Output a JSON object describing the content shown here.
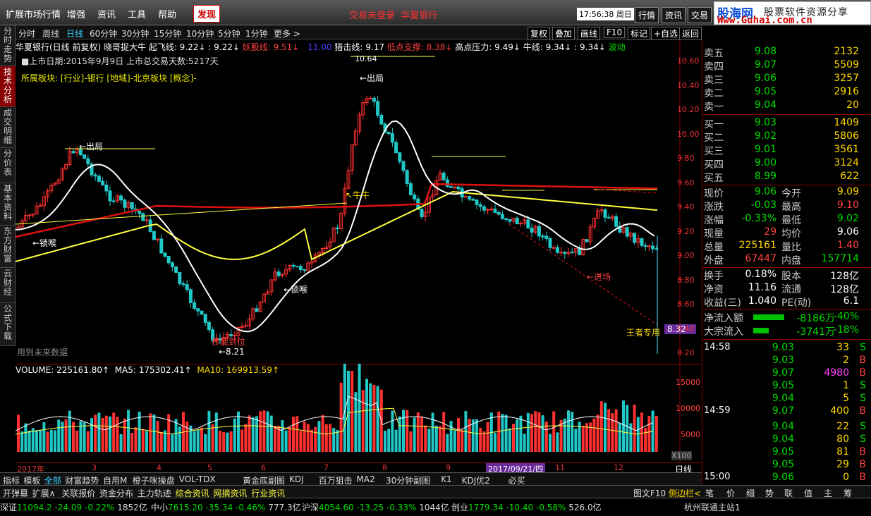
{
  "top_menu": [
    "扩展市场行情",
    "增强",
    "资讯",
    "工具",
    "帮助",
    "发现"
  ],
  "login_status": "交易未登录",
  "stock_header": "华夏银行",
  "clock": "17:56:38 周日",
  "top_buttons": [
    "行情",
    "资讯",
    "交易"
  ],
  "logo": {
    "name": "股海网",
    "slogan": "股票软件资源分享",
    "url": "Www.Guhai.com.cn"
  },
  "left_tabs": [
    "分时走势",
    "技术分析",
    "成交明细",
    "分价表",
    "基本资料",
    "东方财富",
    "云财经",
    "公式下载"
  ],
  "periods": [
    "分时",
    "周线",
    "日线",
    "60分钟",
    "30分钟",
    "15分钟",
    "10分钟",
    "5分钟",
    "1分钟",
    "更多 >"
  ],
  "tools": [
    "复权",
    "叠加",
    "画线",
    "F10",
    "标记",
    "+自选",
    "返回"
  ],
  "indicator_line": {
    "name": "华夏银行(日线 前复权) 晓哥捉大牛",
    "qfx": "起飞线: 9.22↓ : 9.22↓",
    "yfx": "妖股线: 9.51↓",
    "nums": "11.00",
    "ljx": "猎击线: 9.17",
    "ddzc": "低点支撑: 8.38↓",
    "gdyl": "高点压力: 9.49↓",
    "nx": "牛线: 9.34↓ : 9.34↓",
    "bd": "波动"
  },
  "listing_info": "■上市日期:2015年9月9日 上市总交易天数:5217天",
  "sector_info": "所属板块: [行业]-银行 [地域]-北京板块 [概念]-",
  "annotations": {
    "top_high": "10.64",
    "exit1": "←出局",
    "exit2": "←出局",
    "bull": "↖牛牛",
    "lock1": "←锁喉",
    "lock2": "←锁喉",
    "entry": "←进场",
    "bottom": "抄底到位",
    "low": "←8.21",
    "king": "王者专用",
    "price_tag": "8.32",
    "future": "用到未来数据"
  },
  "y_ticks": [
    "10.60",
    "10.40",
    "10.20",
    "10.00",
    "9.80",
    "9.60",
    "9.40",
    "9.20",
    "9.00",
    "8.80",
    "8.60",
    "8.40",
    "8.20"
  ],
  "volume_line": {
    "vol": "VOLUME: 225161.80↑",
    "ma5": "MA5: 175302.41↑",
    "ma10": "MA10: 169913.59↑"
  },
  "vol_ticks": [
    "15000",
    "10000",
    "5000",
    "X100"
  ],
  "dates": [
    "2017年",
    "3",
    "4",
    "5",
    "6",
    "7",
    "8",
    "9",
    "2017/09/21/四",
    "11",
    "12"
  ],
  "timeframe_label": "日线",
  "bottom_tabs": [
    "指标",
    "模板",
    "全部",
    "财富趋势",
    "自用M",
    "橙子咪操盘",
    "VOL-TDX",
    "黄金底副图",
    "KDJ",
    "百万狙击",
    "MA2",
    "30分钟副图",
    "K1",
    "KDJ优2",
    "必买"
  ],
  "bottom_tabs2": [
    "开弹幕",
    "扩展∧",
    "关联报价",
    "资金分布",
    "主力轨迹",
    "综合资讯",
    "网摘资讯",
    "行业资讯",
    "图文F10",
    "侧边栏<",
    "笔",
    "价",
    "细",
    "势",
    "联",
    "值",
    "主",
    "筹"
  ],
  "status": [
    {
      "n": "深证",
      "v": "11094.2",
      "c": "-24.09",
      "p": "-0.22%",
      "a": "1852亿"
    },
    {
      "n": "中小",
      "v": "7615.20",
      "c": "-35.34",
      "p": "-0.46%",
      "a": "777.3亿"
    },
    {
      "n": "沪深",
      "v": "4054.60",
      "c": "-13.25",
      "p": "-0.33%",
      "a": "1044亿"
    },
    {
      "n": "创业",
      "v": "1779.34",
      "c": "-10.40",
      "p": "-0.58%",
      "a": "526.0亿"
    }
  ],
  "server": "杭州联通主站1",
  "order_book": {
    "asks": [
      {
        "l": "卖五",
        "p": "9.08",
        "v": "2132"
      },
      {
        "l": "卖四",
        "p": "9.07",
        "v": "5509"
      },
      {
        "l": "卖三",
        "p": "9.06",
        "v": "3257"
      },
      {
        "l": "卖二",
        "p": "9.05",
        "v": "2916"
      },
      {
        "l": "卖一",
        "p": "9.04",
        "v": "20"
      }
    ],
    "bids": [
      {
        "l": "买一",
        "p": "9.03",
        "v": "1409"
      },
      {
        "l": "买二",
        "p": "9.02",
        "v": "5806"
      },
      {
        "l": "买三",
        "p": "9.01",
        "v": "3561"
      },
      {
        "l": "买四",
        "p": "9.00",
        "v": "3124"
      },
      {
        "l": "买五",
        "p": "8.99",
        "v": "622"
      }
    ]
  },
  "quote": [
    [
      "现价",
      "9.06",
      "今开",
      "9.09"
    ],
    [
      "涨跌",
      "-0.03",
      "最高",
      "9.10"
    ],
    [
      "涨幅",
      "-0.33%",
      "最低",
      "9.02"
    ],
    [
      "现量",
      "29",
      "均价",
      "9.06"
    ],
    [
      "总量",
      "225161",
      "量比",
      "1.40"
    ],
    [
      "外盘",
      "67447",
      "内盘",
      "157714"
    ]
  ],
  "fund": [
    [
      "换手",
      "0.18%",
      "股本",
      "128亿"
    ],
    [
      "净资",
      "11.16",
      "流通",
      "128亿"
    ],
    [
      "收益(三)",
      "1.040",
      "PE(动)",
      "6.1"
    ]
  ],
  "flows": [
    {
      "l": "净流入额",
      "v": "-8186万",
      "p": "-40%"
    },
    {
      "l": "大宗流入",
      "v": "-3741万",
      "p": "-18%"
    }
  ],
  "ticks": [
    {
      "t": "14:58",
      "p": "9.03",
      "v": "33",
      "s": "S"
    },
    {
      "t": "",
      "p": "9.03",
      "v": "2",
      "s": "B"
    },
    {
      "t": "",
      "p": "9.07",
      "v": "4980",
      "s": "B"
    },
    {
      "t": "",
      "p": "9.05",
      "v": "1",
      "s": "S"
    },
    {
      "t": "",
      "p": "9.04",
      "v": "5",
      "s": "S"
    },
    {
      "t": "14:59",
      "p": "9.07",
      "v": "400",
      "s": "B"
    },
    {
      "t": "",
      "p": "9.04",
      "v": "22",
      "s": "S"
    },
    {
      "t": "",
      "p": "9.04",
      "v": "80",
      "s": "S"
    },
    {
      "t": "",
      "p": "9.05",
      "v": "81",
      "s": "B"
    },
    {
      "t": "",
      "p": "9.05",
      "v": "29",
      "s": "B"
    },
    {
      "t": "15:00",
      "p": "9.06",
      "v": "0",
      "s": "B"
    }
  ]
}
